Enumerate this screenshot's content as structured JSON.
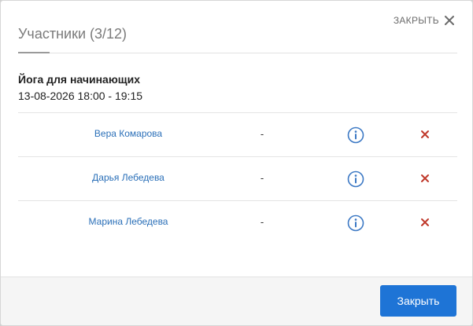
{
  "modal": {
    "close_top_label": "ЗАКРЫТЬ",
    "title": "Участники (3/12)"
  },
  "event": {
    "name": "Йога для начинающих",
    "time": "13-08-2026 18:00 - 19:15"
  },
  "participants": [
    {
      "name": "Вера Комарова",
      "value": "-",
      "info_icon": "info-circle-icon",
      "remove_icon": "remove-x-icon"
    },
    {
      "name": "Дарья Лебедева",
      "value": "-",
      "info_icon": "info-circle-icon",
      "remove_icon": "remove-x-icon"
    },
    {
      "name": "Марина Лебедева",
      "value": "-",
      "info_icon": "info-circle-icon",
      "remove_icon": "remove-x-icon"
    }
  ],
  "footer": {
    "close_button_label": "Закрыть"
  },
  "colors": {
    "link": "#2a6fb8",
    "info": "#3b78c4",
    "remove": "#c0392b",
    "primary_button": "#1e74d6"
  }
}
